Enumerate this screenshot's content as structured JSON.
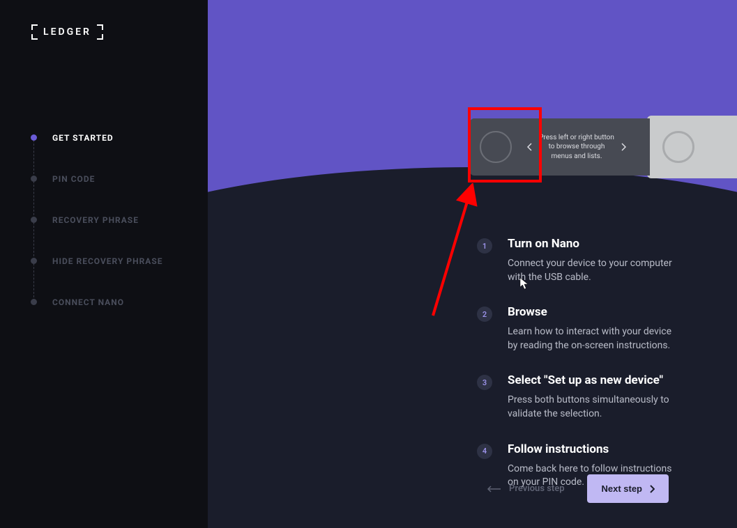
{
  "logo": {
    "text": "LEDGER"
  },
  "sidebar": {
    "steps": [
      {
        "label": "GET STARTED",
        "active": true
      },
      {
        "label": "PIN CODE",
        "active": false
      },
      {
        "label": "RECOVERY PHRASE",
        "active": false
      },
      {
        "label": "HIDE RECOVERY PHRASE",
        "active": false
      },
      {
        "label": "CONNECT NANO",
        "active": false
      }
    ]
  },
  "device": {
    "screen_text": "Press left or right button to browse through menus and lists."
  },
  "instructions": [
    {
      "num": "1",
      "title": "Turn on Nano",
      "desc": "Connect your device to your computer with the USB cable."
    },
    {
      "num": "2",
      "title": "Browse",
      "desc": "Learn how to interact with your device by reading the on-screen instructions."
    },
    {
      "num": "3",
      "title": "Select \"Set up as new device\"",
      "desc": "Press both buttons simultaneously to validate the selection."
    },
    {
      "num": "4",
      "title": "Follow instructions",
      "desc": "Come back here to follow instructions on your PIN code."
    }
  ],
  "nav": {
    "prev": "Previous step",
    "next": "Next step"
  }
}
